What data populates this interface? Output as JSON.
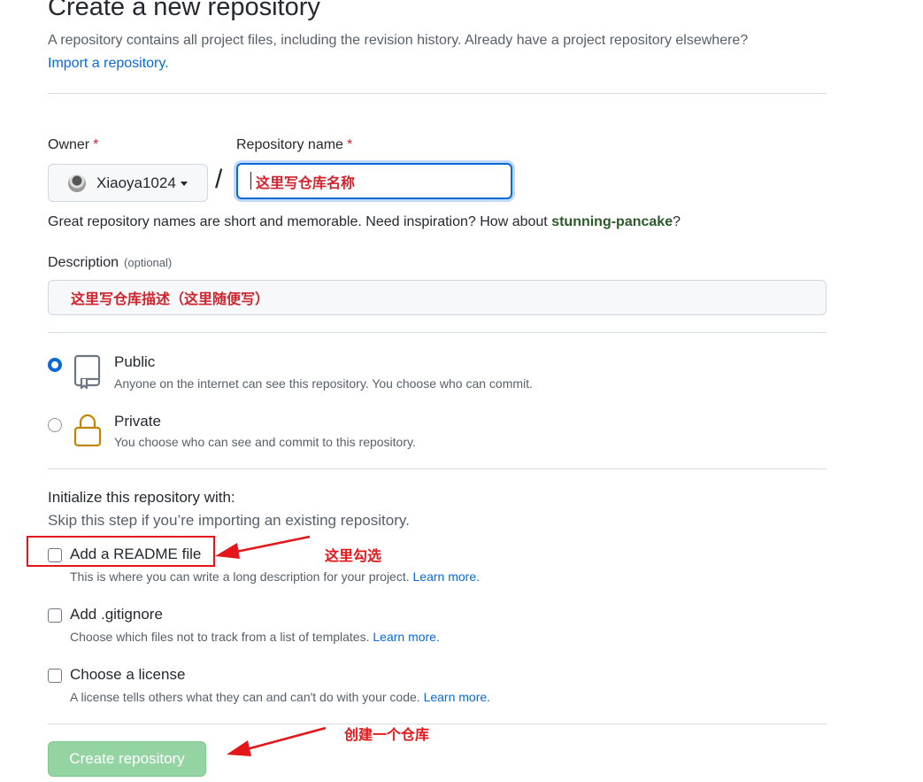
{
  "header": {
    "title": "Create a new repository",
    "subtitle": "A repository contains all project files, including the revision history. Already have a project repository elsewhere?",
    "import_link": "Import a repository."
  },
  "owner": {
    "label": "Owner",
    "required": "*",
    "value": "Xiaoya1024"
  },
  "repo_name": {
    "label": "Repository name",
    "required": "*",
    "separator": "/",
    "value": "这里写仓库名称"
  },
  "name_hint": {
    "text": "Great repository names are short and memorable. Need inspiration? How about ",
    "suggestion": "stunning-pancake",
    "suffix": "?"
  },
  "description": {
    "label": "Description",
    "optional": "(optional)",
    "value": "这里写仓库描述（这里随便写）"
  },
  "visibility": {
    "public": {
      "title": "Public",
      "desc": "Anyone on the internet can see this repository. You choose who can commit.",
      "selected": true
    },
    "private": {
      "title": "Private",
      "desc": "You choose who can see and commit to this repository.",
      "selected": false
    }
  },
  "init": {
    "heading": "Initialize this repository with:",
    "sub": "Skip this step if you’re importing an existing repository.",
    "readme": {
      "title": "Add a README file",
      "desc": "This is where you can write a long description for your project.",
      "link": "Learn more."
    },
    "gitignore": {
      "title": "Add .gitignore",
      "desc": "Choose which files not to track from a list of templates.",
      "link": "Learn more."
    },
    "license": {
      "title": "Choose a license",
      "desc": "A license tells others what they can and can't do with your code.",
      "link": "Learn more."
    }
  },
  "annotations": {
    "check_here": "这里勾选",
    "create_one": "创建一个仓库"
  },
  "create_button": "Create repository",
  "colors": {
    "accent": "#0969da",
    "annotation_red": "#e5161a",
    "create_button_bg": "#94d3a2"
  }
}
